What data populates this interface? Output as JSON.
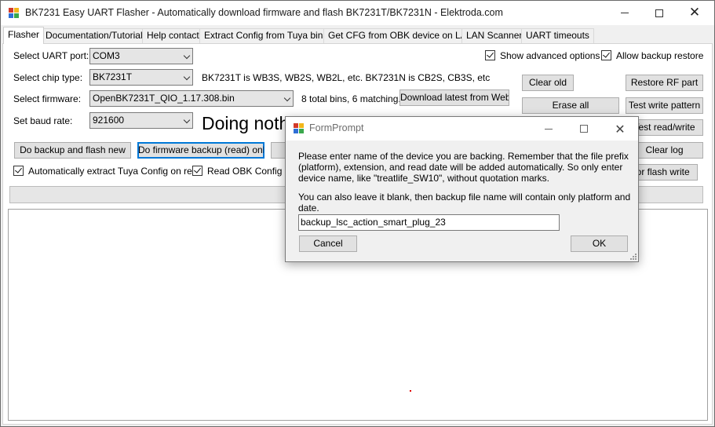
{
  "window": {
    "title": "BK7231 Easy UART Flasher - Automatically download firmware and flash BK7231T/BK7231N  -  Elektroda.com",
    "controls": {
      "minimize": "minimize-icon",
      "maximize": "maximize-icon",
      "close": "close-icon"
    }
  },
  "tabs": [
    {
      "label": "Flasher",
      "active": true
    },
    {
      "label": "Documentation/Tutorials"
    },
    {
      "label": "Help contact"
    },
    {
      "label": "Extract Config from Tuya binary"
    },
    {
      "label": "Get CFG from OBK device on LAN"
    },
    {
      "label": "LAN Scanner"
    },
    {
      "label": "UART timeouts"
    }
  ],
  "flasher": {
    "uart_port_label": "Select UART port:",
    "uart_port_value": "COM3",
    "chip_type_label": "Select chip type:",
    "chip_type_value": "BK7231T",
    "chip_info": "BK7231T is WB3S, WB2S, WB2L, etc. BK7231N is CB2S, CB3S, etc",
    "firmware_label": "Select firmware:",
    "firmware_value": "OpenBK7231T_QIO_1.17.308.bin",
    "bins_info": "8 total bins, 6 matching.",
    "download_latest_label": "Download latest from Web",
    "baud_label": "Set baud rate:",
    "baud_value": "921600",
    "status_text": "Doing nothing",
    "backup_flash_label": "Do backup and flash new",
    "firmware_backup_label": "Do firmware backup (read) only",
    "auto_extract_label": "Automatically extract Tuya Config on read",
    "auto_extract_checked": true,
    "read_obk_label": "Read OBK Config if p",
    "read_obk_checked": true,
    "show_advanced_label": "Show advanced options",
    "show_advanced_checked": true,
    "allow_backup_label": "Allow backup restore",
    "allow_backup_checked": true,
    "clear_old_label": "Clear old",
    "erase_all_label": "Erase all",
    "restore_rf_label": "Restore RF part",
    "test_write_label": "Test write pattern",
    "test_read_write_label": "Test read/write",
    "clear_log_label": "Clear log",
    "flash_write_label": "for flash write"
  },
  "dialog": {
    "title": "FormPrompt",
    "message_1": "Please enter name of the device you are backing. Remember that the file prefix (platform), extension, and read date will be added automatically. So only enter device name, like \"treatlife_SW10\", without quotation marks.",
    "message_2": "You can also leave it blank, then backup file name will contain only platform and date.",
    "input_value": "backup_lsc_action_smart_plug_23",
    "cancel_label": "Cancel",
    "ok_label": "OK"
  },
  "colors": {
    "window_bg": "#f0f0f0",
    "focus_blue": "#0078d7",
    "icon_red": "#d23a2a",
    "icon_yellow": "#f2b619",
    "icon_blue": "#2f6fd6",
    "icon_green": "#3aa84c",
    "log_marker": "#e00000"
  }
}
